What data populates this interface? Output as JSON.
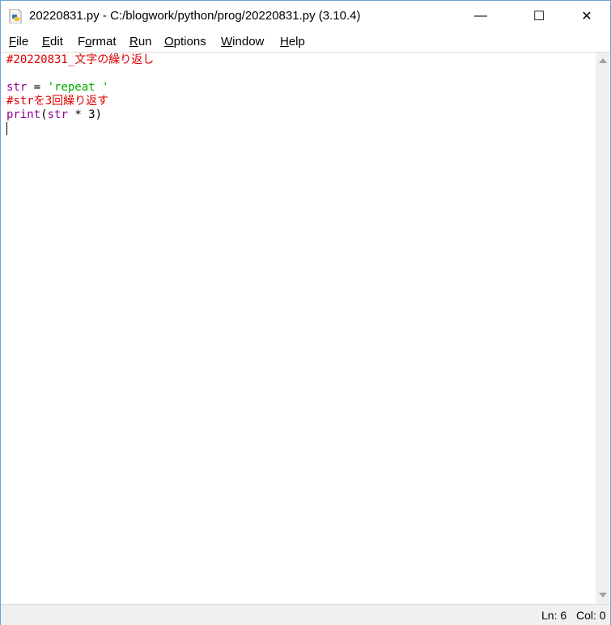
{
  "window": {
    "title": "20220831.py - C:/blogwork/python/prog/20220831.py (3.10.4)",
    "minimize": "—",
    "maximize": "☐",
    "close": "✕"
  },
  "menu": [
    {
      "label": "File",
      "u": "F",
      "rest": "ile"
    },
    {
      "label": "Edit",
      "u": "E",
      "rest": "dit"
    },
    {
      "label": "Format",
      "pre": "F",
      "u": "o",
      "rest": "rmat"
    },
    {
      "label": "Run",
      "u": "R",
      "rest": "un"
    },
    {
      "label": "Options",
      "u": "O",
      "rest": "ptions"
    },
    {
      "label": "Window",
      "u": "W",
      "rest": "indow"
    },
    {
      "label": "Help",
      "u": "H",
      "rest": "elp"
    }
  ],
  "code": {
    "line1": "#20220831_文字の繰り返し",
    "line3_name": "str",
    "line3_eq": " = ",
    "line3_str": "'repeat '",
    "line4": "#strを3回繰り返す",
    "line5_fn": "print",
    "line5_open": "(",
    "line5_var": "str",
    "line5_rest": " * 3)"
  },
  "status": {
    "line": "Ln: 6",
    "col": "Col: 0"
  }
}
